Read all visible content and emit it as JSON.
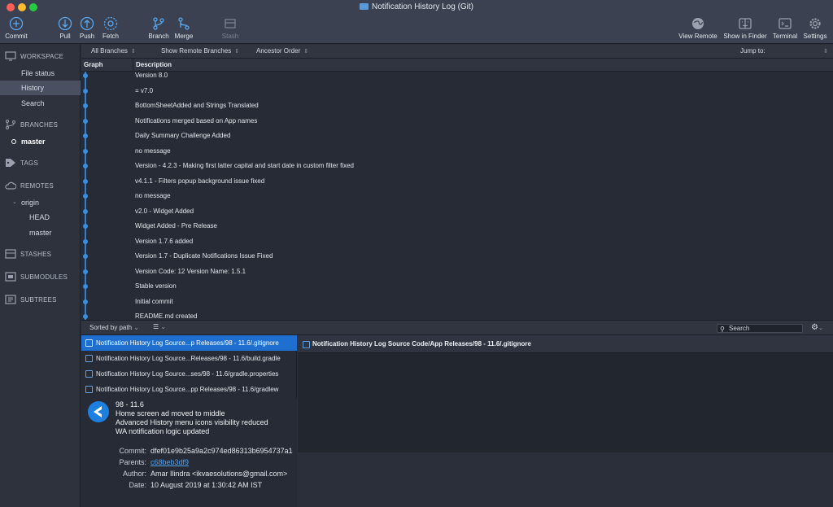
{
  "window": {
    "title": "Notification History Log (Git)"
  },
  "toolbar": {
    "left": [
      {
        "label": "Commit",
        "icon": "commit-icon"
      },
      {
        "label": "Pull",
        "icon": "pull-icon"
      },
      {
        "label": "Push",
        "icon": "push-icon"
      },
      {
        "label": "Fetch",
        "icon": "fetch-icon"
      },
      {
        "label": "Branch",
        "icon": "branch-icon"
      },
      {
        "label": "Merge",
        "icon": "merge-icon"
      },
      {
        "label": "Stash",
        "icon": "stash-icon",
        "disabled": true
      }
    ],
    "right": [
      {
        "label": "View Remote",
        "icon": "globe-icon"
      },
      {
        "label": "Show in Finder",
        "icon": "finder-icon"
      },
      {
        "label": "Terminal",
        "icon": "terminal-icon"
      },
      {
        "label": "Settings",
        "icon": "gear-icon"
      }
    ]
  },
  "sidebar": {
    "workspace": "WORKSPACE",
    "workspace_items": [
      "File status",
      "History",
      "Search"
    ],
    "selected_workspace": "History",
    "branches": "BRANCHES",
    "branch_items": [
      "master"
    ],
    "tags": "TAGS",
    "remotes": "REMOTES",
    "remote_name": "origin",
    "remote_items": [
      "HEAD",
      "master"
    ],
    "stashes": "STASHES",
    "submodules": "SUBMODULES",
    "subtrees": "SUBTREES"
  },
  "filters": {
    "branches": "All Branches",
    "remote": "Show Remote Branches",
    "order": "Ancestor Order",
    "jump_to": "Jump to:"
  },
  "columns": {
    "graph": "Graph",
    "description": "Description"
  },
  "commits": [
    "Version 8.0",
    "= v7.0",
    "BottomSheetAdded and Strings Translated",
    "Notifications merged based on App names",
    "Daily Summary Challenge Added",
    "no message",
    "Version - 4.2.3 - Making first latter capital and start date in custom filter fixed",
    "v4.1.1 - Filters popup background issue fixed",
    "no message",
    "v2.0 - Widget Added",
    "Widget Added - Pre Release",
    "Version 1.7.6 added",
    "Version 1.7 - Duplicate Notifications Issue Fixed",
    "Version Code: 12 Version Name: 1.5.1",
    "Stable version",
    "Initial commit",
    "README.md created"
  ],
  "bottom_bar": {
    "sort": "Sorted by path",
    "search_placeholder": "Search"
  },
  "files": [
    "Notification History Log Source...p Releases/98 - 11.6/.gitignore",
    "Notification History Log Source...Releases/98 - 11.6/build.gradle",
    "Notification History Log Source...ses/98 - 11.6/gradle.properties",
    "Notification History Log Source...pp Releases/98 - 11.6/gradlew"
  ],
  "commit_detail": {
    "message": [
      "98 - 11.6",
      "Home screen ad moved to middle",
      "Advanced History menu icons visibility reduced",
      "WA notification logic updated"
    ],
    "labels": {
      "commit": "Commit:",
      "parents": "Parents:",
      "author": "Author:",
      "date": "Date:"
    },
    "commit": "dfef01e9b25a9a2c974ed86313b6954737a1",
    "parents": "c68beb3df9",
    "author": "Amar Ilindra <ikvaesolutions@gmail.com>",
    "date": "10 August 2019 at 1:30:42 AM IST"
  },
  "diff": {
    "file": "Notification History Log Source Code/App Releases/98 - 11.6/.gitignore"
  },
  "colors": {
    "accent": "#1f6fd1",
    "graph": "#2f7fd1",
    "link": "#4ea1f3"
  }
}
